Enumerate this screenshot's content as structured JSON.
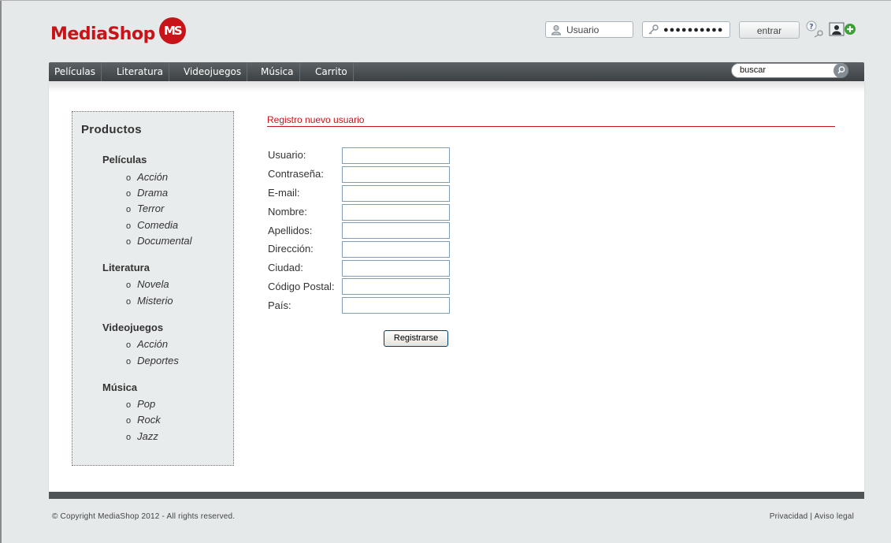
{
  "brand": {
    "name": "MediaShop",
    "mark": "MS",
    "color": "#c81418"
  },
  "login": {
    "user_placeholder": "Usuario",
    "password_value": "●●●●●●●●●●",
    "enter_label": "entrar"
  },
  "nav": {
    "items": [
      "Películas",
      "Literatura",
      "Videojuegos",
      "Música",
      "Carrito"
    ],
    "search_value": "buscar"
  },
  "sidebar": {
    "title": "Productos",
    "categories": [
      {
        "name": "Películas",
        "items": [
          "Acción",
          "Drama",
          "Terror",
          "Comedia",
          "Documental"
        ]
      },
      {
        "name": "Literatura",
        "items": [
          "Novela",
          "Misterio"
        ]
      },
      {
        "name": "Videojuegos",
        "items": [
          "Acción",
          "Deportes"
        ]
      },
      {
        "name": "Música",
        "items": [
          "Pop",
          "Rock",
          "Jazz"
        ]
      }
    ]
  },
  "form": {
    "title": "Registro nuevo usuario",
    "fields": [
      "Usuario:",
      "Contraseña:",
      "E-mail:",
      "Nombre:",
      "Apellidos:",
      "Dirección:",
      "Ciudad:",
      "Código Postal:",
      "País:"
    ],
    "submit_label": "Registrarse"
  },
  "footer": {
    "copyright": "© Copyright MediaShop 2012 - All rights reserved.",
    "legal": "Privacidad | Aviso legal"
  }
}
